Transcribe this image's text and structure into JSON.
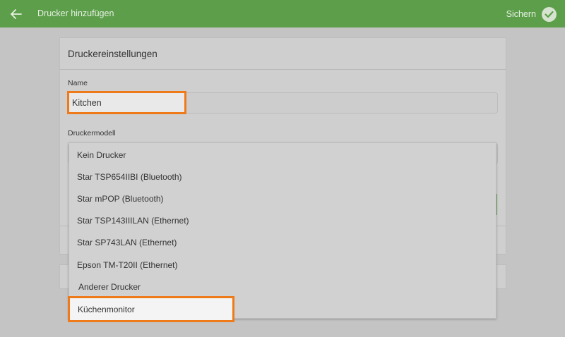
{
  "appbar": {
    "title": "Drucker hinzufügen",
    "back_icon": "arrow-left-icon",
    "save_label": "Sichern",
    "save_icon": "check-circle-icon",
    "color": "#5c9e4a"
  },
  "card": {
    "title": "Druckereinstellungen",
    "name_label": "Name",
    "name_value": "Kitchen",
    "model_label": "Druckermodell"
  },
  "dropdown": {
    "options": [
      "Kein Drucker",
      "Star TSP654IIBI (Bluetooth)",
      "Star mPOP (Bluetooth)",
      "Star TSP143IIILAN (Ethernet)",
      "Star SP743LAN (Ethernet)",
      "Epson TM-T20II (Ethernet)",
      "Anderer Drucker",
      "Küchenmonitor"
    ]
  },
  "highlight_color": "#ef7a1a"
}
